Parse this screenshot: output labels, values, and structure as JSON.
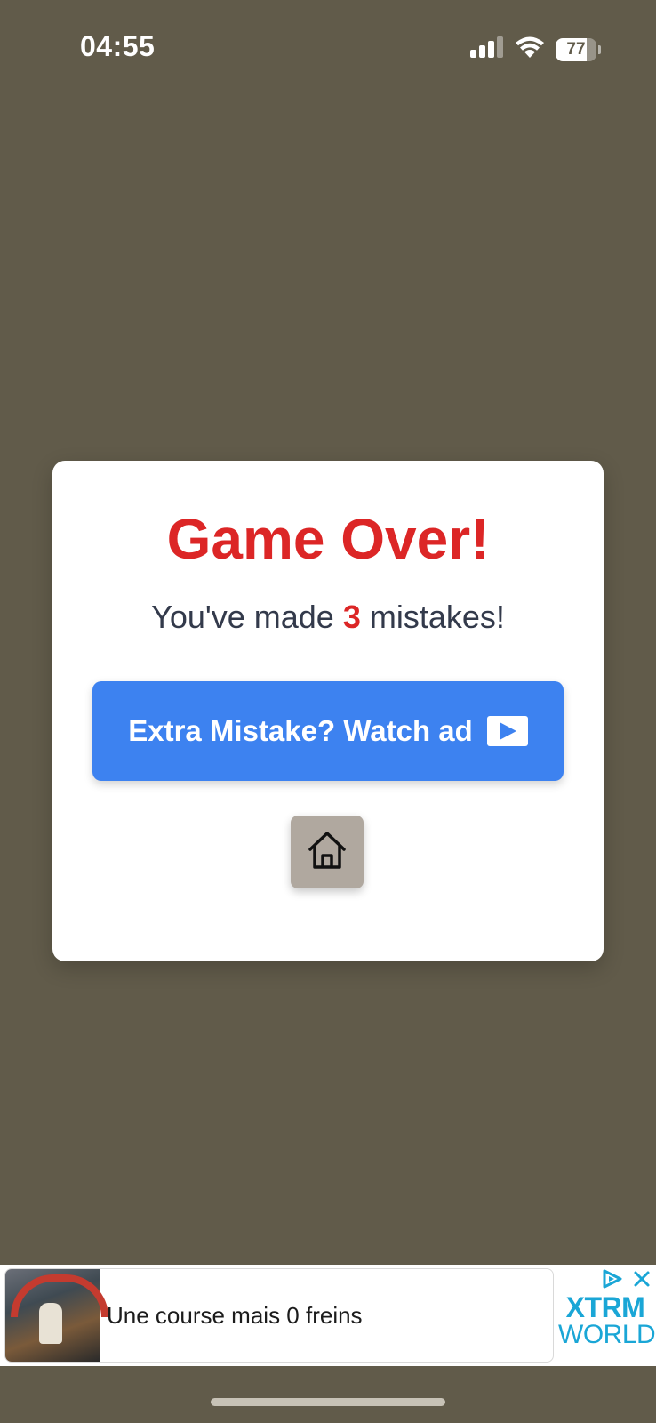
{
  "status_bar": {
    "time": "04:55",
    "battery_level": "77",
    "battery_fraction": 0.77,
    "signal_bars_active": 3,
    "signal_bars_total": 4
  },
  "modal": {
    "title": "Game Over!",
    "message_prefix": "You've made ",
    "mistake_count": "3",
    "message_suffix": " mistakes!",
    "ad_button_label": "Extra Mistake? Watch ad",
    "home_button_icon": "home-icon"
  },
  "ad_banner": {
    "headline": "Une course mais 0 freins",
    "brand_line1": "XTRM",
    "brand_line2": "WORLD"
  },
  "colors": {
    "background": "#615b4a",
    "title_red": "#dc2626",
    "button_blue": "#3d82f0",
    "home_button_gray": "#b0a89f",
    "ad_brand_blue": "#1aa6d6"
  }
}
